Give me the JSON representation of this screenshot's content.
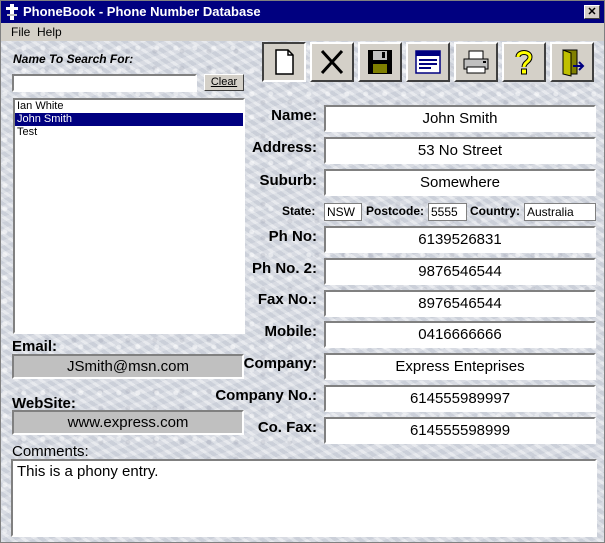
{
  "window": {
    "title": "PhoneBook - Phone Number Database",
    "close_glyph": "✕"
  },
  "menu": [
    "File",
    "Help"
  ],
  "search": {
    "label": "Name To Search For:",
    "value": "",
    "clear_label": "Clear"
  },
  "names": [
    {
      "name": "Ian White",
      "selected": false
    },
    {
      "name": "John Smith",
      "selected": true
    },
    {
      "name": "Test",
      "selected": false
    }
  ],
  "toolbar": [
    "new-icon",
    "delete-icon",
    "save-icon",
    "view-icon",
    "print-icon",
    "help-icon",
    "exit-icon"
  ],
  "form": {
    "name_label": "Name:",
    "name": "John Smith",
    "address_label": "Address:",
    "address": "53 No Street",
    "suburb_label": "Suburb:",
    "suburb": "Somewhere",
    "state_label": "State:",
    "state": "NSW",
    "postcode_label": "Postcode:",
    "postcode": "5555",
    "country_label": "Country:",
    "country": "Australia",
    "phone_label": "Ph No:",
    "phone": "6139526831",
    "phone2_label": "Ph No. 2:",
    "phone2": "9876546544",
    "fax_label": "Fax No.:",
    "fax": "8976546544",
    "mobile_label": "Mobile:",
    "mobile": "0416666666",
    "company_label": "Company:",
    "company": "Express Enteprises",
    "company_no_label": "Company No.:",
    "company_no": "614555989997",
    "co_fax_label": "Co. Fax:",
    "co_fax": "614555598999"
  },
  "email": {
    "label": "Email:",
    "value": "JSmith@msn.com"
  },
  "website": {
    "label": "WebSite:",
    "value": "www.express.com"
  },
  "comments": {
    "label": "Comments:",
    "value": "This is a phony entry."
  },
  "colors": {
    "title_bar": "#000080",
    "selection": "#000080",
    "face": "#d4d0c8"
  }
}
